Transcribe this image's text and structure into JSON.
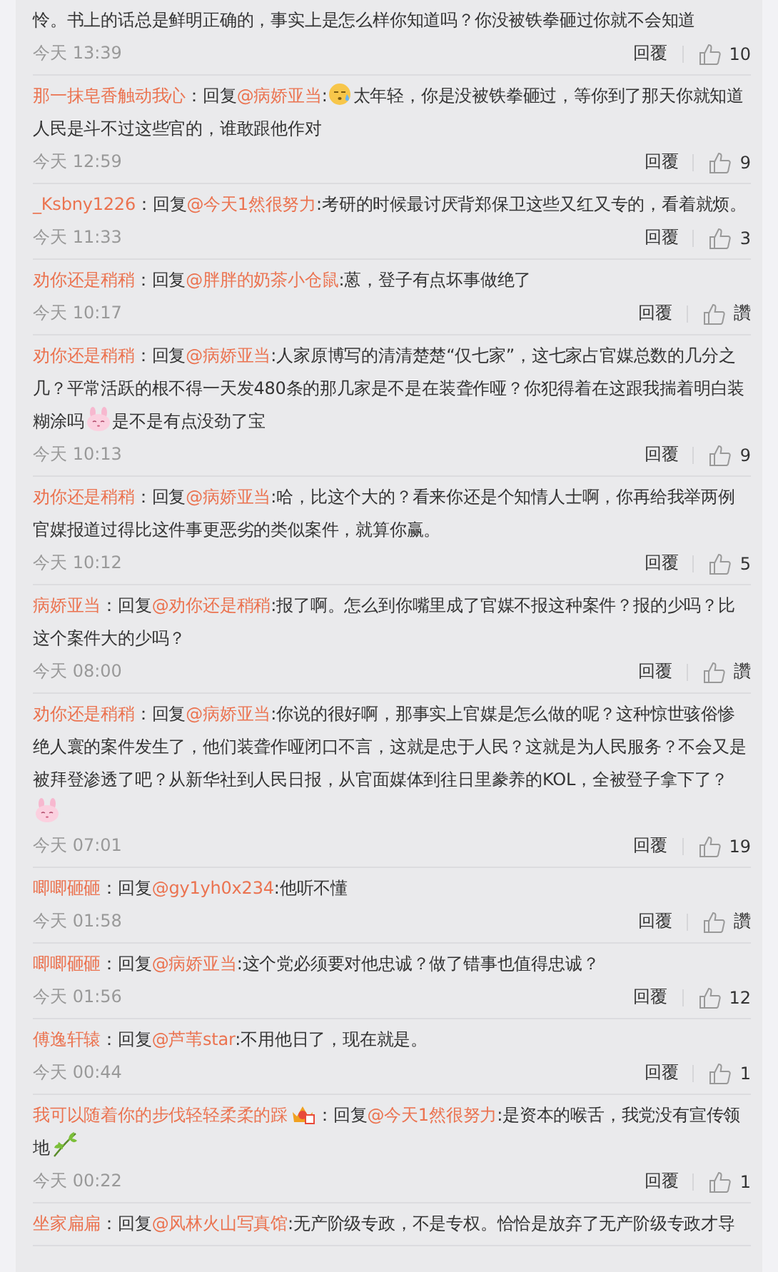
{
  "comments": [
    {
      "body": [
        {
          "kind": "text",
          "text": "怜。书上的话总是鲜明正确的，事实上是怎么样你知道吗？你没被铁拳砸过你就不会知道"
        }
      ],
      "time": "今天 13:39",
      "reply": "回覆",
      "likes": "10"
    },
    {
      "author": "那一抹皂香触动我心",
      "prefix": "：回复",
      "mention": "@病娇亚当",
      "body": [
        {
          "kind": "text",
          "text": ":"
        },
        {
          "kind": "sweat"
        },
        {
          "kind": "text",
          "text": "太年轻，你是没被铁拳砸过，等你到了那天你就知道人民是斗不过这些官的，谁敢跟他作对"
        }
      ],
      "time": "今天 12:59",
      "reply": "回覆",
      "likes": "9"
    },
    {
      "author": "_Ksbny1226",
      "prefix": "：回复",
      "mention": "@今天1然很努力",
      "body": [
        {
          "kind": "text",
          "text": ":考研的时候最讨厌背郑保卫这些又红又专的，看着就烦。"
        }
      ],
      "time": "今天 11:33",
      "reply": "回覆",
      "likes": "3"
    },
    {
      "author": "劝你还是稍稍",
      "prefix": "：回复",
      "mention": "@胖胖的奶茶小仓鼠",
      "body": [
        {
          "kind": "text",
          "text": ":蒽，登子有点坏事做绝了"
        }
      ],
      "time": "今天 10:17",
      "reply": "回覆",
      "likes": "讚"
    },
    {
      "author": "劝你还是稍稍",
      "prefix": "：回复",
      "mention": "@病娇亚当",
      "body": [
        {
          "kind": "text",
          "text": ":人家原博写的清清楚楚“仅七家”，这七家占官媒总数的几分之几？平常活跃的根不得一天发480条的那几家是不是在装聋作哑？你犯得着在这跟我揣着明白装糊涂吗"
        },
        {
          "kind": "bunny"
        },
        {
          "kind": "text",
          "text": "是不是有点没劲了宝"
        }
      ],
      "time": "今天 10:13",
      "reply": "回覆",
      "likes": "9"
    },
    {
      "author": "劝你还是稍稍",
      "prefix": "：回复",
      "mention": "@病娇亚当",
      "body": [
        {
          "kind": "text",
          "text": ":哈，比这个大的？看来你还是个知情人士啊，你再给我举两例官媒报道过得比这件事更恶劣的类似案件，就算你赢。"
        }
      ],
      "time": "今天 10:12",
      "reply": "回覆",
      "likes": "5"
    },
    {
      "author": "病娇亚当",
      "prefix": "：回复",
      "mention": "@劝你还是稍稍",
      "body": [
        {
          "kind": "text",
          "text": ":报了啊。怎么到你嘴里成了官媒不报这种案件？报的少吗？比这个案件大的少吗？"
        }
      ],
      "time": "今天 08:00",
      "reply": "回覆",
      "likes": "讚"
    },
    {
      "author": "劝你还是稍稍",
      "prefix": "：回复",
      "mention": "@病娇亚当",
      "body": [
        {
          "kind": "text",
          "text": ":你说的很好啊，那事实上官媒是怎么做的呢？这种惊世骇俗惨绝人寰的案件发生了，他们装聋作哑闭口不言，这就是忠于人民？这就是为人民服务？不会又是被拜登渗透了吧？从新华社到人民日报，从官面媒体到往日里豢养的KOL，全被登子拿下了？"
        },
        {
          "kind": "bunny"
        }
      ],
      "time": "今天 07:01",
      "reply": "回覆",
      "likes": "19"
    },
    {
      "author": "唧唧砸砸",
      "prefix": "：回复",
      "mention": "@gy1yh0x234",
      "body": [
        {
          "kind": "text",
          "text": ":他听不懂"
        }
      ],
      "time": "今天 01:58",
      "reply": "回覆",
      "likes": "讚"
    },
    {
      "author": "唧唧砸砸",
      "prefix": "：回复",
      "mention": "@病娇亚当",
      "body": [
        {
          "kind": "text",
          "text": ":这个党必须要对他忠诚？做了错事也值得忠诚？"
        }
      ],
      "time": "今天 01:56",
      "reply": "回覆",
      "likes": "12"
    },
    {
      "author": "傅逸轩辕",
      "prefix": "：回复",
      "mention": "@芦苇star",
      "body": [
        {
          "kind": "text",
          "text": ":不用他日了，现在就是。"
        }
      ],
      "time": "今天 00:44",
      "reply": "回覆",
      "likes": "1"
    },
    {
      "author": "我可以随着你的步伐轻轻柔柔的踩",
      "author_marks": [
        {
          "kind": "crown"
        }
      ],
      "prefix": "：回复",
      "mention": "@今天1然很努力",
      "body": [
        {
          "kind": "text",
          "text": ":是资本的喉舌，我党没有宣传领地"
        },
        {
          "kind": "leaf"
        }
      ],
      "time": "今天 00:22",
      "reply": "回覆",
      "likes": "1"
    },
    {
      "author": "坐家扁扁",
      "prefix": "：回复",
      "mention": "@风林火山写真馆",
      "body": [
        {
          "kind": "text",
          "text": ":无产阶级专政，不是专权。恰恰是放弃了无产阶级专政才导"
        }
      ]
    }
  ]
}
